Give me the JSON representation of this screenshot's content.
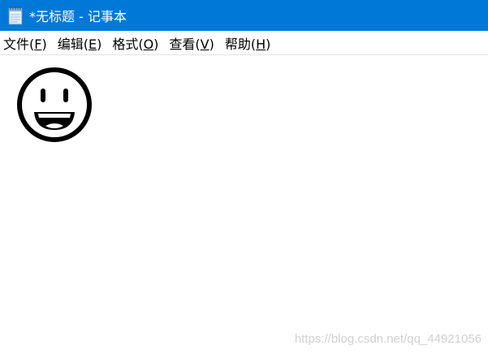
{
  "window": {
    "title": "*无标题 - 记事本",
    "app_icon": "notepad-icon",
    "titlebar_color": "#0078d7"
  },
  "menubar": {
    "items": [
      {
        "label": "文件(",
        "accel": "F",
        "tail": ")"
      },
      {
        "label": "编辑(",
        "accel": "E",
        "tail": ")"
      },
      {
        "label": "格式(",
        "accel": "O",
        "tail": ")"
      },
      {
        "label": "查看(",
        "accel": "V",
        "tail": ")"
      },
      {
        "label": "帮助(",
        "accel": "H",
        "tail": ")"
      }
    ]
  },
  "editor": {
    "content_icon": "grinning-face-icon"
  },
  "watermark": "https://blog.csdn.net/qq_44921056"
}
